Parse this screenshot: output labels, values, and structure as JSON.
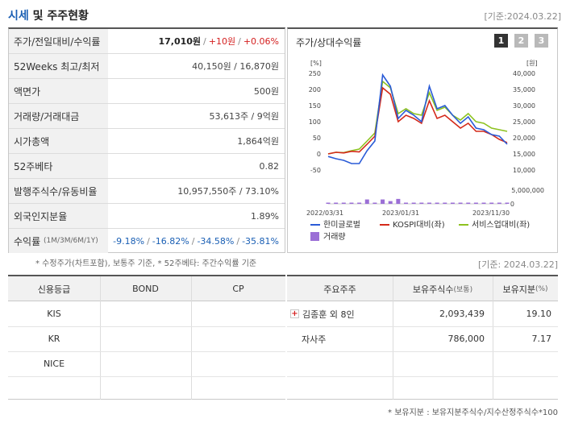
{
  "header": {
    "title_main": "시세",
    "title_rest": " 및 주주현황",
    "date": "[기준:2024.03.22]"
  },
  "price_table": {
    "rows": [
      {
        "label": "주가/전일대비/수익률",
        "price": "17,010원",
        "change": "+10원",
        "rate": "+0.06%"
      },
      {
        "label": "52Weeks 최고/최저",
        "value": "40,150원 / 16,870원"
      },
      {
        "label": "액면가",
        "value": "500원"
      },
      {
        "label": "거래량/거래대금",
        "value": "53,613주 / 9억원"
      },
      {
        "label": "시가총액",
        "value": "1,864억원"
      },
      {
        "label": "52주베타",
        "value": "0.82"
      },
      {
        "label": "발행주식수/유동비율",
        "value": "10,957,550주 / 73.10%"
      },
      {
        "label": "외국인지분율",
        "value": "1.89%"
      },
      {
        "label": "수익률",
        "label_small": "(1M/3M/6M/1Y)",
        "r1": "-9.18%",
        "r2": "-16.82%",
        "r3": "-34.58%",
        "r4": "-35.81%"
      }
    ],
    "note": "* 수정주가(차트포함), 보통주 기준, * 52주베타: 주간수익률 기준"
  },
  "chart": {
    "title": "주가/상대수익률",
    "pages": [
      "1",
      "2",
      "3"
    ],
    "left_unit": "[%]",
    "right_unit": "[원]",
    "legend": [
      "한미글로벌",
      "KOSPI대비(좌)",
      "서비스업대비(좌)",
      "거래량"
    ],
    "colors": {
      "main": "#2a5bd7",
      "kospi": "#d42a1a",
      "service": "#8dc21f",
      "volume": "#9b6fd6"
    }
  },
  "chart_data": {
    "type": "line",
    "left_axis": {
      "ticks": [
        "250",
        "200",
        "150",
        "100",
        "50",
        "0",
        "-50"
      ],
      "range": [
        -50,
        250
      ]
    },
    "right_axis": {
      "ticks": [
        "40,000",
        "35,000",
        "30,000",
        "25,000",
        "20,000",
        "15,000",
        "10,000"
      ],
      "range": [
        10000,
        40000
      ]
    },
    "volume_axis": {
      "ticks": [
        "5,000,000",
        "0"
      ],
      "range": [
        0,
        5000000
      ]
    },
    "x_labels": [
      "2022/03/31",
      "2023/01/31",
      "2023/11/30"
    ],
    "series": [
      {
        "name": "한미글로벌",
        "values": [
          -8,
          -15,
          -20,
          -30,
          -30,
          10,
          40,
          245,
          210,
          110,
          135,
          120,
          100,
          210,
          140,
          150,
          120,
          95,
          115,
          80,
          75,
          60,
          55,
          30
        ]
      },
      {
        "name": "KOSPI대비(좌)",
        "values": [
          0,
          5,
          3,
          8,
          6,
          30,
          55,
          205,
          185,
          100,
          120,
          110,
          95,
          165,
          110,
          120,
          100,
          80,
          95,
          70,
          70,
          60,
          45,
          35
        ]
      },
      {
        "name": "서비스업대비(좌)",
        "values": [
          0,
          5,
          4,
          10,
          15,
          40,
          65,
          225,
          205,
          125,
          140,
          125,
          120,
          190,
          135,
          145,
          120,
          105,
          125,
          100,
          95,
          80,
          75,
          70
        ]
      }
    ],
    "volume": [
      100000,
      50000,
      50000,
      50000,
      200000,
      1600000,
      300000,
      1600000,
      1000000,
      1800000,
      300000,
      150000,
      100000,
      200000,
      350000,
      150000,
      50000,
      50000,
      100000,
      50000,
      80000,
      60000,
      40000,
      30000
    ]
  },
  "credit_table": {
    "headers": [
      "신용등급",
      "BOND",
      "CP"
    ],
    "rows": [
      [
        "KIS",
        "",
        ""
      ],
      [
        "KR",
        "",
        ""
      ],
      [
        "NICE",
        "",
        ""
      ],
      [
        "",
        "",
        ""
      ]
    ]
  },
  "shareholder_table": {
    "date": "[기준: 2024.03.22]",
    "headers": [
      "주요주주",
      "보유주식수",
      "(보통)",
      "보유지분",
      "(%)"
    ],
    "rows": [
      {
        "name": "김종훈 외 8인",
        "shares": "2,093,439",
        "pct": "19.10",
        "icon": "plus-icon"
      },
      {
        "name": "자사주",
        "shares": "786,000",
        "pct": "7.17"
      }
    ],
    "note": "* 보유지분 : 보유지분주식수/지수산정주식수*100"
  }
}
